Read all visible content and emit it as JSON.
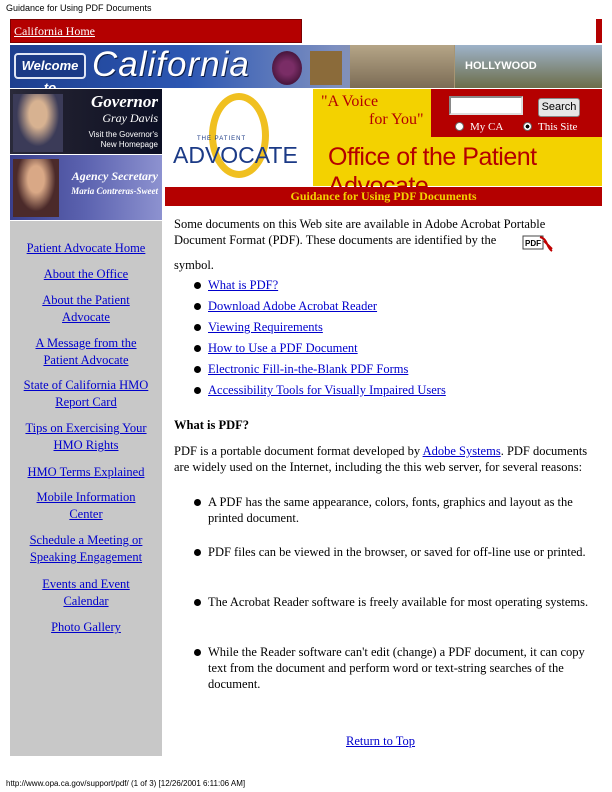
{
  "print_header": "Guidance for Using PDF Documents",
  "print_footer": "http://www.opa.ca.gov/support/pdf/ (1 of 3) [12/26/2001 6:11:06 AM]",
  "topbar": {
    "home_link": "California Home"
  },
  "banner": {
    "welcome": "Welcome to",
    "california": "California",
    "hollywood": "HOLLYWOOD"
  },
  "governor": {
    "title": "Governor",
    "name": "Gray Davis",
    "link_line1": "Visit the Governor's",
    "link_line2": "New Homepage"
  },
  "agency": {
    "title": "Agency Secretary",
    "name": "Maria Contreras-Sweet"
  },
  "logo": {
    "small": "THE PATIENT",
    "big": "ADVOCATE"
  },
  "voice": {
    "line1": "\"A Voice",
    "line2": "for You\""
  },
  "search": {
    "input_value": "",
    "button": "Search",
    "option_myca": "My CA",
    "option_site": "This Site",
    "selected": "This Site"
  },
  "office_title": "Office of the Patient Advocate",
  "page_title": "Guidance for Using PDF Documents",
  "sidebar": {
    "items": [
      "Patient Advocate Home",
      "About the Office",
      "About the Patient Advocate",
      "A Message from the Patient Advocate",
      "State of California HMO Report Card",
      "Tips on Exercising Your HMO Rights",
      "HMO Terms Explained",
      "Mobile Information Center",
      "Schedule a Meeting or Speaking Engagement",
      "Events and Event Calendar",
      "Photo Gallery"
    ]
  },
  "intro": "Some documents on this Web site are available in Adobe Acrobat Portable Document Format (PDF). These documents are identified by the",
  "pdf_icon_label": "PDF",
  "symbol_text": "symbol.",
  "toc": [
    "What is PDF?",
    "Download Adobe Acrobat Reader",
    "Viewing Requirements",
    "How to Use a PDF Document",
    "Electronic Fill-in-the-Blank PDF Forms",
    "Accessibility Tools for Visually Impaired Users"
  ],
  "what_heading": "What is PDF?",
  "para_before": "PDF is a portable document format developed by ",
  "para_link": "Adobe Systems",
  "para_after": ". PDF documents are widely used on the Internet, including the this web server, for several reasons:",
  "reasons": [
    "A PDF has the same appearance, colors, fonts, graphics and layout as the printed document.",
    "PDF files can be viewed in the browser, or saved for off-line use or printed.",
    "The Acrobat Reader software is freely available for most operating systems.",
    "While the Reader software can't edit (change) a PDF document, it can copy text from the document and perform word or text-string searches of the document."
  ],
  "return_top": "Return to Top",
  "colors": {
    "red": "#b40000",
    "yellow": "#f3d200",
    "blue_link": "#0000cc",
    "sidebar_gray": "#c8c8c8",
    "advocate_blue": "#1b3a86"
  }
}
